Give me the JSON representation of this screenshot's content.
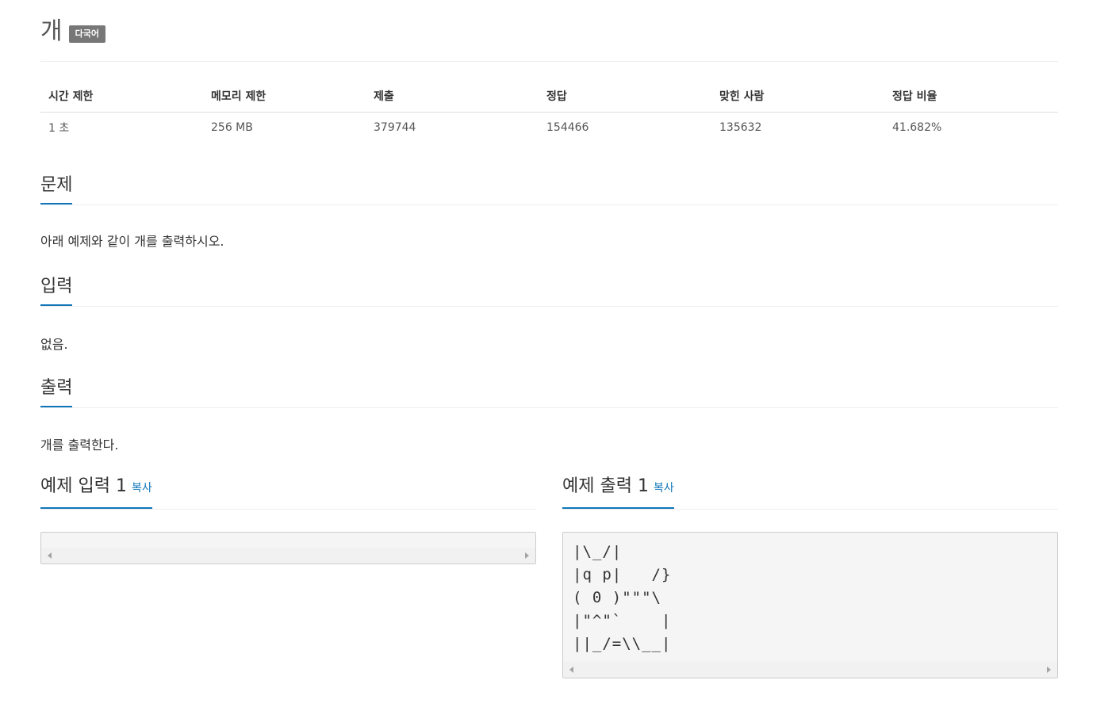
{
  "problem": {
    "title": "개",
    "badge": "다국어"
  },
  "info_table": {
    "headers": [
      "시간 제한",
      "메모리 제한",
      "제출",
      "정답",
      "맞힌 사람",
      "정답 비율"
    ],
    "values": [
      "1 초",
      "256 MB",
      "379744",
      "154466",
      "135632",
      "41.682%"
    ]
  },
  "sections": {
    "problem": {
      "title": "문제",
      "body": "아래 예제와 같이 개를 출력하시오."
    },
    "input": {
      "title": "입력",
      "body": "없음."
    },
    "output": {
      "title": "출력",
      "body": "개를 출력한다."
    }
  },
  "samples": {
    "input": {
      "title": "예제 입력 1",
      "copy_label": "복사",
      "content": ""
    },
    "output": {
      "title": "예제 출력 1",
      "copy_label": "복사",
      "content": "|\\_/|\n|q p|   /}\n( 0 )\"\"\"\\\n|\"^\"`    |\n||_/=\\\\__|"
    }
  },
  "colors": {
    "accent": "#0e76b8",
    "badge_bg": "#777777",
    "code_bg": "#f5f5f5"
  }
}
